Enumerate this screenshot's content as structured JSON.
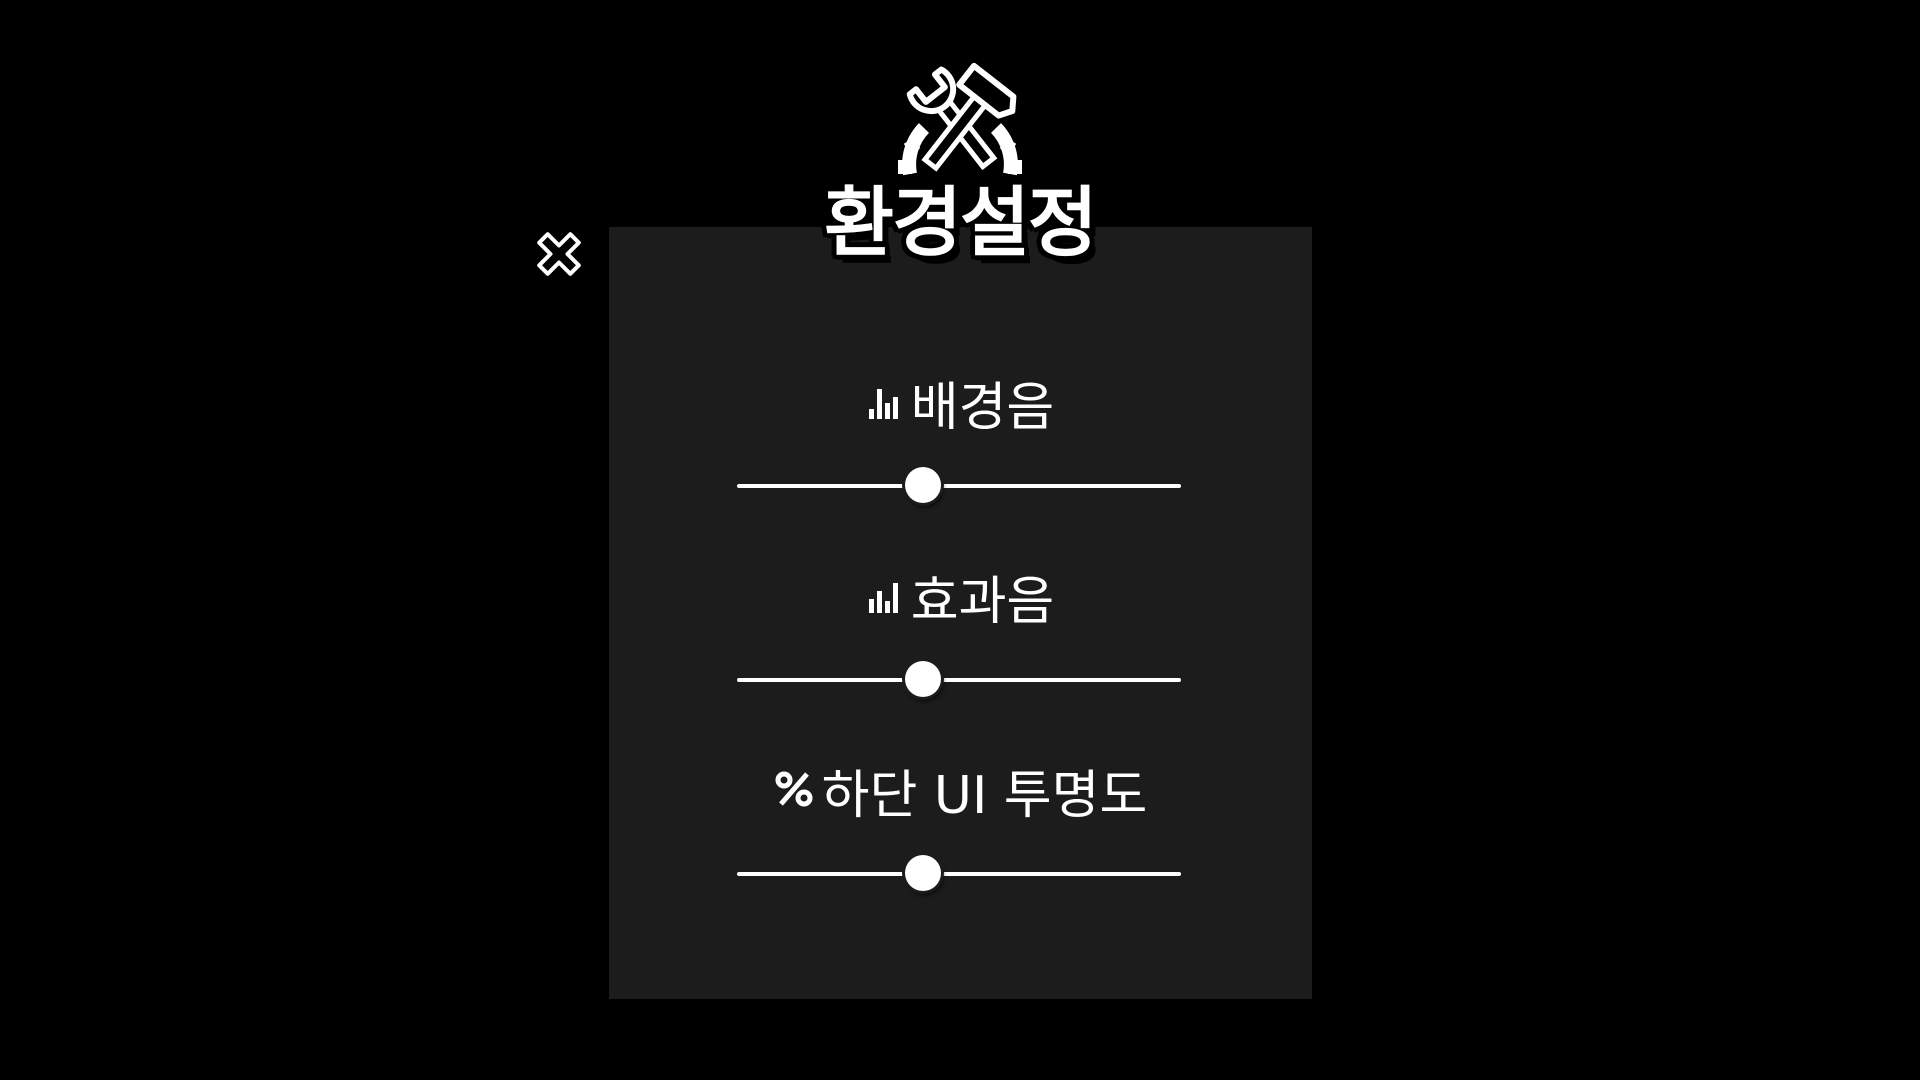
{
  "window": {
    "title": "환경설정",
    "background_color": "#000000",
    "panel_color": "#1c1c1c",
    "accent_color": "#ffffff"
  },
  "header": {
    "emblem_icon": "tools-wrench-hammer-icon",
    "close_icon": "close-x-icon"
  },
  "settings": [
    {
      "label": "배경음",
      "icon": "volume-bars-icon",
      "value": 0.42
    },
    {
      "label": "효과음",
      "icon": "volume-bars-icon",
      "value": 0.42
    },
    {
      "label": "하단 UI 투명도",
      "icon": "percent-icon",
      "value": 0.42
    }
  ]
}
